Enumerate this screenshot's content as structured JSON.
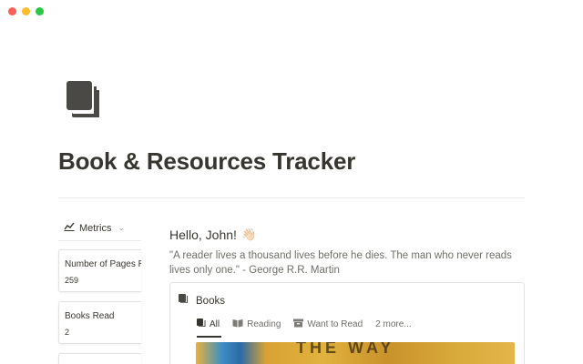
{
  "window": {
    "colors": {
      "close": "#ff5f57",
      "minimize": "#febc2e",
      "maximize": "#28c840"
    }
  },
  "page": {
    "icon": "books-icon",
    "title": "Book & Resources Tracker"
  },
  "metrics": {
    "header_label": "Metrics",
    "header_icon": "chart-icon",
    "cards": [
      {
        "label": "Number of Pages R",
        "value": "259"
      },
      {
        "label": "Books Read",
        "value": "2"
      }
    ]
  },
  "content": {
    "greeting": "Hello, John!",
    "greeting_emoji": "👋🏻",
    "quote": "\"A reader lives a thousand lives before he dies. The man who never reads lives only one.\" - George R.R. Martin",
    "books": {
      "title": "Books",
      "tabs": [
        {
          "label": "All",
          "icon": "book-icon",
          "active": true
        },
        {
          "label": "Reading",
          "icon": "open-book-icon",
          "active": false
        },
        {
          "label": "Want to Read",
          "icon": "archive-icon",
          "active": false
        },
        {
          "label": "2 more...",
          "icon": "",
          "active": false
        }
      ],
      "cover_text": "THE WAY"
    }
  }
}
